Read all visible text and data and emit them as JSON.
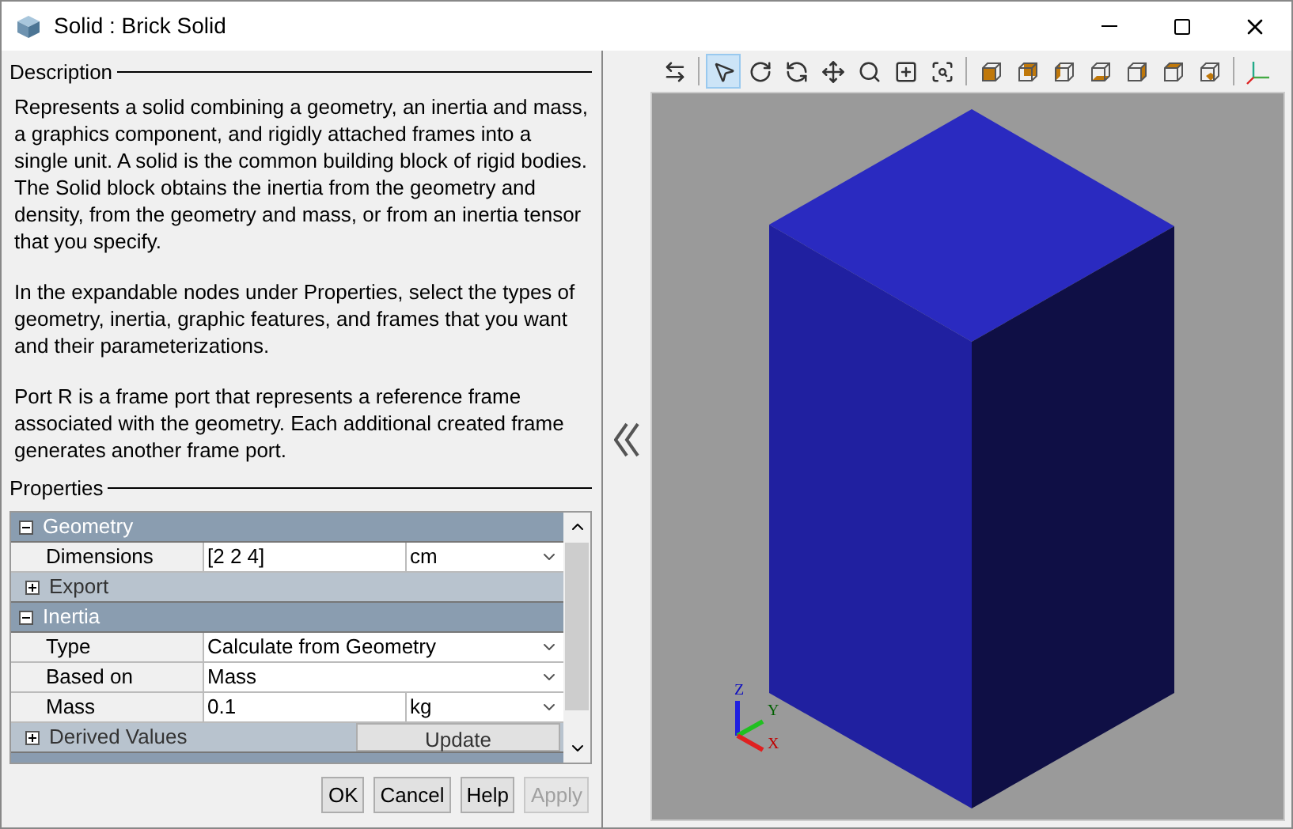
{
  "window": {
    "title": "Solid : Brick Solid"
  },
  "description": {
    "legend": "Description",
    "paragraphs": [
      "Represents a solid combining a geometry, an inertia and mass, a graphics component, and rigidly attached frames into a single unit. A solid is the common building block of rigid bodies. The Solid block obtains the inertia from the geometry and density, from the geometry and mass, or from an inertia tensor that you specify.",
      "In the expandable nodes under Properties, select the types of geometry, inertia, graphic features, and frames that you want and their parameterizations.",
      "Port R is a frame port that represents a reference frame associated with the geometry. Each additional created frame generates another frame port."
    ]
  },
  "properties": {
    "legend": "Properties",
    "rows": [
      {
        "kind": "group",
        "label": "Geometry",
        "expanded": true
      },
      {
        "kind": "value_unit",
        "label": "Dimensions",
        "value": "[2 2 4]",
        "unit": "cm"
      },
      {
        "kind": "subgroup",
        "label": "Export",
        "expanded": false
      },
      {
        "kind": "group",
        "label": "Inertia",
        "expanded": true
      },
      {
        "kind": "choice",
        "label": "Type",
        "value": "Calculate from Geometry"
      },
      {
        "kind": "choice",
        "label": "Based on",
        "value": "Mass"
      },
      {
        "kind": "value_unit",
        "label": "Mass",
        "value": "0.1",
        "unit": "kg"
      },
      {
        "kind": "subgroup",
        "label": "Derived Values",
        "expanded": false,
        "button": "Update"
      }
    ]
  },
  "buttons": [
    {
      "label": "OK",
      "disabled": false
    },
    {
      "label": "Cancel",
      "disabled": false
    },
    {
      "label": "Help",
      "disabled": false
    },
    {
      "label": "Apply",
      "disabled": true
    }
  ],
  "toolbar": [
    [
      {
        "kind": "swap",
        "selected": false
      }
    ],
    [
      {
        "kind": "select",
        "selected": true
      },
      {
        "kind": "rotate",
        "selected": false
      },
      {
        "kind": "roll",
        "selected": false
      },
      {
        "kind": "pan",
        "selected": false
      },
      {
        "kind": "zoom",
        "selected": false
      },
      {
        "kind": "box-zoom",
        "selected": false
      },
      {
        "kind": "fit",
        "selected": false
      }
    ],
    [
      {
        "kind": "front",
        "selected": false
      },
      {
        "kind": "back",
        "selected": false
      },
      {
        "kind": "left",
        "selected": false
      },
      {
        "kind": "bottom",
        "selected": false
      },
      {
        "kind": "right",
        "selected": false
      },
      {
        "kind": "top",
        "selected": false
      },
      {
        "kind": "iso",
        "selected": false
      }
    ],
    [
      {
        "kind": "triad",
        "selected": false
      }
    ]
  ],
  "viewport": {
    "axes": [
      "Z",
      "Y",
      "X"
    ]
  }
}
